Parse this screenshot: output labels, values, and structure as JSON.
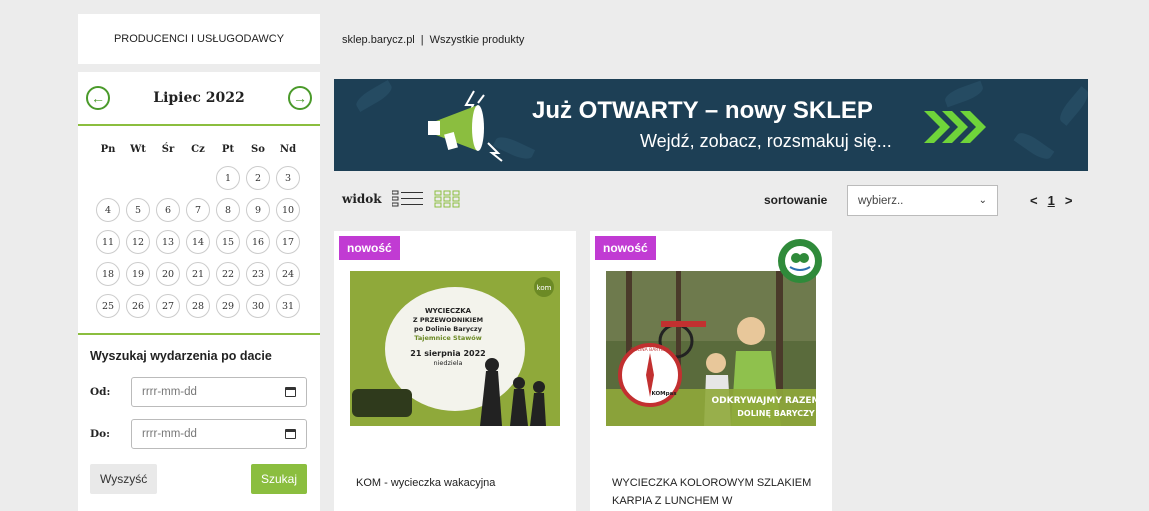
{
  "sidebar": {
    "producers_label": "PRODUCENCI I USŁUGODAWCY",
    "calendar": {
      "month": "Lipiec 2022",
      "weekdays": [
        "Pn",
        "Wt",
        "Śr",
        "Cz",
        "Pt",
        "So",
        "Nd"
      ],
      "leading_blanks": 4,
      "days": [
        "1",
        "2",
        "3",
        "4",
        "5",
        "6",
        "7",
        "8",
        "9",
        "10",
        "11",
        "12",
        "13",
        "14",
        "15",
        "16",
        "17",
        "18",
        "19",
        "20",
        "21",
        "22",
        "23",
        "24",
        "25",
        "26",
        "27",
        "28",
        "29",
        "30",
        "31"
      ]
    },
    "search": {
      "title": "Wyszukaj wydarzenia po dacie",
      "from_label": "Od:",
      "to_label": "Do:",
      "from_placeholder": "rrrr-mm-dd",
      "to_placeholder": "rrrr-mm-dd",
      "clear_label": "Wyszyść",
      "search_label": "Szukaj"
    }
  },
  "breadcrumb": {
    "home": "sklep.barycz.pl",
    "separator": "|",
    "current": "Wszystkie produkty"
  },
  "banner": {
    "title": "Już OTWARTY – nowy SKLEP",
    "subtitle": "Wejdź, zobacz, rozsmakuj się..."
  },
  "toolbar": {
    "view_label": "widok",
    "sort_label": "sortowanie",
    "sort_value": "wybierz..",
    "pager": {
      "prev": "<",
      "current": "1",
      "next": ">"
    }
  },
  "products": [
    {
      "badge": "nowość",
      "title": "KOM - wycieczka wakacyjna",
      "image_text": {
        "logo": "kom",
        "line1": "WYCIECZKA",
        "line2": "Z PRZEWODNIKIEM",
        "line3": "po Dolinie Baryczy",
        "line4": "Tajemnice Stawów",
        "date": "21 sierpnia 2022",
        "day": "niedziela"
      }
    },
    {
      "badge": "nowość",
      "title": "WYCIECZKA KOLOROWYM SZLAKIEM KARPIA Z LUNCHEM W",
      "image_text": {
        "seal": "DOLINA BARYCZY",
        "compass": "KOMpas",
        "caption1": "ODKRYWAJMY RAZEM",
        "caption2": "DOLINĘ BARYCZY"
      }
    }
  ],
  "colors": {
    "accent_green": "#8bbe3f",
    "banner_bg": "#1d3f55",
    "badge": "#c13bd3"
  }
}
